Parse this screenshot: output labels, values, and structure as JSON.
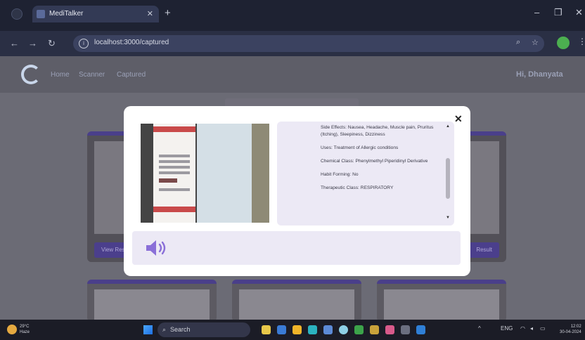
{
  "browser": {
    "tab_title": "MediTalker",
    "url": "localhost:3000/captured"
  },
  "app": {
    "nav_home": "Home",
    "nav_scanner": "Scanner",
    "nav_captured": "Captured",
    "greeting": "Hi, Dhanyata"
  },
  "cards": {
    "btn_left": "View Result",
    "btn_right": "Result"
  },
  "modal": {
    "info_lines": [
      "Side Effects: Nausea, Headache, Muscle pain, Pruritus (Itching), Sleepiness, Dizziness",
      "Uses: Treatment of Allergic conditions",
      "Chemical Class: Phenylmethyl Piperidinyl Derivative",
      "Habit Forming: No",
      "Therapeutic Class: RESPIRATORY"
    ]
  },
  "taskbar": {
    "search_placeholder": "Search",
    "weather_temp": "29°C",
    "weather_text": "Haze",
    "clock_time": "12:02",
    "clock_date": "30-04-2024"
  },
  "colors": {
    "modal_accent": "#ece9f5",
    "speaker": "#8a6fd8",
    "card_button": "#4b3f8c"
  },
  "icons": [
    "close-icon",
    "speaker-icon",
    "windows-start-icon",
    "search-icon"
  ]
}
